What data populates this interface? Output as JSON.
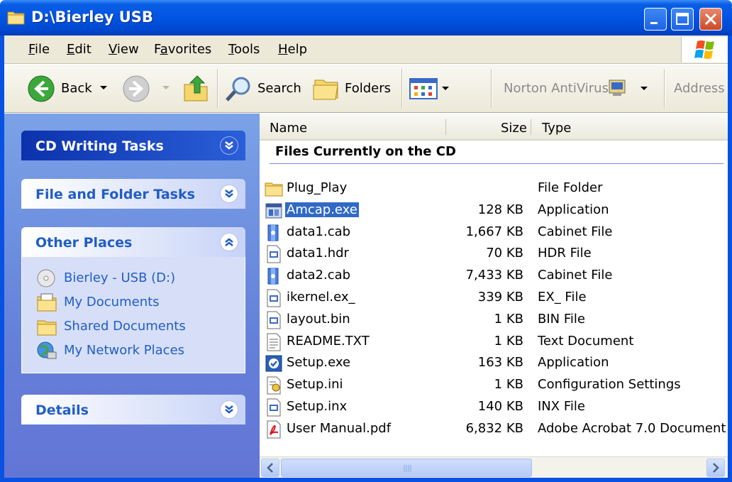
{
  "window": {
    "title": "D:\\Bierley USB"
  },
  "menu": [
    {
      "label": "File",
      "accel": "F",
      "rest": "ile"
    },
    {
      "label": "Edit",
      "accel": "E",
      "rest": "dit"
    },
    {
      "label": "View",
      "accel": "V",
      "rest": "iew"
    },
    {
      "label": "Favorites",
      "pre": "F",
      "accel": "a",
      "rest": "vorites"
    },
    {
      "label": "Tools",
      "accel": "T",
      "rest": "ools"
    },
    {
      "label": "Help",
      "accel": "H",
      "rest": "elp"
    }
  ],
  "toolbar": {
    "back": "Back",
    "search": "Search",
    "folders": "Folders",
    "norton": "Norton AntiVirus",
    "address": "Address"
  },
  "taskpane": {
    "cd_writing": "CD Writing Tasks",
    "file_folder": "File and Folder Tasks",
    "other_places": "Other Places",
    "places": [
      {
        "label": "Bierley - USB (D:)",
        "icon": "drive-icon"
      },
      {
        "label": "My Documents",
        "icon": "my-documents-icon"
      },
      {
        "label": "Shared Documents",
        "icon": "shared-folder-icon"
      },
      {
        "label": "My Network Places",
        "icon": "network-icon"
      }
    ],
    "details": "Details"
  },
  "filelist": {
    "columns": {
      "name": "Name",
      "size": "Size",
      "type": "Type"
    },
    "group_title": "Files Currently on the CD",
    "files": [
      {
        "name": "Plug_Play",
        "size": "",
        "type": "File Folder",
        "icon": "folder-icon",
        "selected": false
      },
      {
        "name": "Amcap.exe",
        "size": "128 KB",
        "type": "Application",
        "icon": "application-icon",
        "selected": true
      },
      {
        "name": "data1.cab",
        "size": "1,667 KB",
        "type": "Cabinet File",
        "icon": "cabinet-icon",
        "selected": false
      },
      {
        "name": "data1.hdr",
        "size": "70 KB",
        "type": "HDR File",
        "icon": "generic-file-icon",
        "selected": false
      },
      {
        "name": "data2.cab",
        "size": "7,433 KB",
        "type": "Cabinet File",
        "icon": "cabinet-icon",
        "selected": false
      },
      {
        "name": "ikernel.ex_",
        "size": "339 KB",
        "type": "EX_ File",
        "icon": "generic-file-icon",
        "selected": false
      },
      {
        "name": "layout.bin",
        "size": "1 KB",
        "type": "BIN File",
        "icon": "generic-file-icon",
        "selected": false
      },
      {
        "name": "README.TXT",
        "size": "1 KB",
        "type": "Text Document",
        "icon": "text-file-icon",
        "selected": false
      },
      {
        "name": "Setup.exe",
        "size": "163 KB",
        "type": "Application",
        "icon": "setup-icon",
        "selected": false
      },
      {
        "name": "Setup.ini",
        "size": "1 KB",
        "type": "Configuration Settings",
        "icon": "settings-file-icon",
        "selected": false
      },
      {
        "name": "Setup.inx",
        "size": "140 KB",
        "type": "INX File",
        "icon": "generic-file-icon",
        "selected": false
      },
      {
        "name": "User Manual.pdf",
        "size": "6,832 KB",
        "type": "Adobe Acrobat 7.0 Document",
        "icon": "pdf-icon",
        "selected": false
      }
    ]
  },
  "colors": {
    "title_bar": "#0054e3",
    "selection": "#316ac5",
    "link": "#215dc6",
    "taskpane": "#6f8fdc"
  }
}
